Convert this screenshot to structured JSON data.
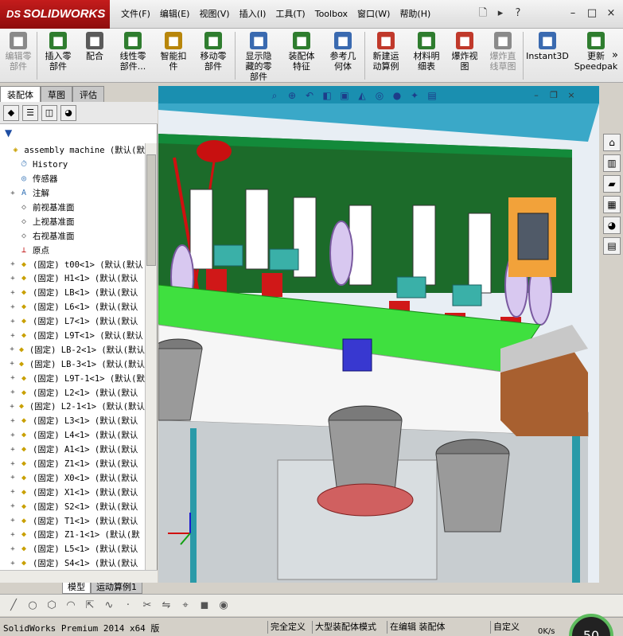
{
  "app": {
    "logo": "SOLIDWORKS",
    "logo_prefix": "DS"
  },
  "menu": [
    "文件(F)",
    "编辑(E)",
    "视图(V)",
    "插入(I)",
    "工具(T)",
    "Toolbox",
    "窗口(W)",
    "帮助(H)"
  ],
  "command_manager": [
    {
      "label": "编辑零\n部件",
      "disabled": true,
      "icon": "edit-component-icon",
      "color": "#8a8a8a"
    },
    {
      "label": "插入零\n部件",
      "disabled": false,
      "icon": "insert-component-icon",
      "color": "#2f7d2f"
    },
    {
      "label": "配合",
      "disabled": false,
      "icon": "mate-icon",
      "color": "#5a5a5a"
    },
    {
      "label": "线性零\n部件...",
      "disabled": false,
      "icon": "linear-pattern-icon",
      "color": "#2f7d2f"
    },
    {
      "label": "智能扣\n件",
      "disabled": false,
      "icon": "smart-fastener-icon",
      "color": "#b8860b"
    },
    {
      "label": "移动零\n部件",
      "disabled": false,
      "icon": "move-component-icon",
      "color": "#2f7d2f"
    },
    {
      "label": "显示隐\n藏的零\n部件",
      "disabled": false,
      "icon": "show-hidden-icon",
      "color": "#3a6ab0"
    },
    {
      "label": "装配体\n特征",
      "disabled": false,
      "icon": "assembly-feature-icon",
      "color": "#2f7d2f"
    },
    {
      "label": "参考几\n何体",
      "disabled": false,
      "icon": "reference-geometry-icon",
      "color": "#3a6ab0"
    },
    {
      "label": "新建运\n动算例",
      "disabled": false,
      "icon": "motion-study-icon",
      "color": "#c0392b"
    },
    {
      "label": "材料明\n细表",
      "disabled": false,
      "icon": "bom-icon",
      "color": "#2f7d2f"
    },
    {
      "label": "爆炸视\n图",
      "disabled": false,
      "icon": "exploded-view-icon",
      "color": "#c0392b"
    },
    {
      "label": "爆炸直\n线草图",
      "disabled": true,
      "icon": "explode-line-icon",
      "color": "#8a8a8a"
    },
    {
      "label": "Instant3D",
      "disabled": false,
      "icon": "instant3d-icon",
      "color": "#3a6ab0"
    },
    {
      "label": "更新\nSpeedpak",
      "disabled": false,
      "icon": "speedpak-icon",
      "color": "#2f7d2f"
    }
  ],
  "left_tabs": [
    "装配体",
    "草图",
    "评估"
  ],
  "tree": [
    {
      "label": "assembly machine  (默认(默",
      "type": "root",
      "expand": "",
      "icon": "assembly-icon"
    },
    {
      "label": "History",
      "type": "item",
      "expand": "",
      "icon": "history-icon"
    },
    {
      "label": "传感器",
      "type": "item",
      "expand": "",
      "icon": "sensor-icon"
    },
    {
      "label": "注解",
      "type": "item",
      "expand": "+",
      "icon": "annotation-icon"
    },
    {
      "label": "前视基准面",
      "type": "item",
      "expand": "",
      "icon": "plane-icon"
    },
    {
      "label": "上视基准面",
      "type": "item",
      "expand": "",
      "icon": "plane-icon"
    },
    {
      "label": "右视基准面",
      "type": "item",
      "expand": "",
      "icon": "plane-icon"
    },
    {
      "label": "原点",
      "type": "item",
      "expand": "",
      "icon": "origin-icon"
    },
    {
      "label": "(固定) t00<1> (默认(默认",
      "type": "part",
      "expand": "+",
      "icon": "part-icon"
    },
    {
      "label": "(固定) H1<1> (默认(默认",
      "type": "part",
      "expand": "+",
      "icon": "part-icon"
    },
    {
      "label": "(固定) LB<1> (默认(默认",
      "type": "part",
      "expand": "+",
      "icon": "part-icon"
    },
    {
      "label": "(固定) L6<1> (默认(默认",
      "type": "part",
      "expand": "+",
      "icon": "part-icon"
    },
    {
      "label": "(固定) L7<1> (默认(默认",
      "type": "part",
      "expand": "+",
      "icon": "part-icon"
    },
    {
      "label": "(固定) L9T<1> (默认(默认",
      "type": "part",
      "expand": "+",
      "icon": "part-icon"
    },
    {
      "label": "(固定) LB-2<1> (默认(默认",
      "type": "part",
      "expand": "+",
      "icon": "part-icon"
    },
    {
      "label": "(固定) LB-3<1> (默认(默认",
      "type": "part",
      "expand": "+",
      "icon": "part-icon"
    },
    {
      "label": "(固定) L9T-1<1> (默认(默",
      "type": "part",
      "expand": "+",
      "icon": "part-icon"
    },
    {
      "label": "(固定) L2<1> (默认(默认",
      "type": "part",
      "expand": "+",
      "icon": "part-icon"
    },
    {
      "label": "(固定) L2-1<1> (默认(默认",
      "type": "part",
      "expand": "+",
      "icon": "part-icon"
    },
    {
      "label": "(固定) L3<1> (默认(默认",
      "type": "part",
      "expand": "+",
      "icon": "part-icon"
    },
    {
      "label": "(固定) L4<1> (默认(默认",
      "type": "part",
      "expand": "+",
      "icon": "part-icon"
    },
    {
      "label": "(固定) A1<1> (默认(默认",
      "type": "part",
      "expand": "+",
      "icon": "part-icon"
    },
    {
      "label": "(固定) Z1<1> (默认(默认",
      "type": "part",
      "expand": "+",
      "icon": "part-icon"
    },
    {
      "label": "(固定) X0<1> (默认(默认",
      "type": "part",
      "expand": "+",
      "icon": "part-icon"
    },
    {
      "label": "(固定) X1<1> (默认(默认",
      "type": "part",
      "expand": "+",
      "icon": "part-icon"
    },
    {
      "label": "(固定) S2<1> (默认(默认",
      "type": "part",
      "expand": "+",
      "icon": "part-icon"
    },
    {
      "label": "(固定) T1<1> (默认(默认",
      "type": "part",
      "expand": "+",
      "icon": "part-icon"
    },
    {
      "label": "(固定) Z1-1<1> (默认(默",
      "type": "part",
      "expand": "+",
      "icon": "part-icon"
    },
    {
      "label": "(固定) L5<1> (默认(默认",
      "type": "part",
      "expand": "+",
      "icon": "part-icon"
    },
    {
      "label": "(固定) S4<1> (默认(默认",
      "type": "part",
      "expand": "+",
      "icon": "part-icon"
    }
  ],
  "bottom_tabs": [
    "模型",
    "运动算例1"
  ],
  "status": {
    "text": "SolidWorks Premium 2014 x64 版",
    "fields": [
      "完全定义",
      "大型装配体模式",
      "在编辑 装配体",
      "自定义"
    ],
    "speed": "0K/s",
    "gauge": "50"
  }
}
